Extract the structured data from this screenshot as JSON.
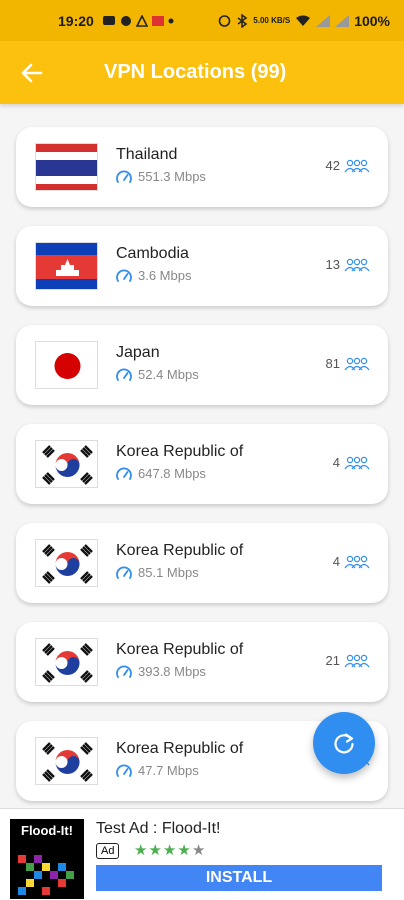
{
  "status_bar": {
    "time": "19:20",
    "battery": "100%",
    "network_speed": "5.00 KB/S"
  },
  "app_bar": {
    "title": "VPN Locations (99)",
    "background": "#fcc10f",
    "back_icon": "arrow-back-icon"
  },
  "locations": [
    {
      "country": "Thailand",
      "speed": "551.3 Mbps",
      "users": "42",
      "flag": "thailand"
    },
    {
      "country": "Cambodia",
      "speed": "3.6 Mbps",
      "users": "13",
      "flag": "cambodia"
    },
    {
      "country": "Japan",
      "speed": "52.4 Mbps",
      "users": "81",
      "flag": "japan"
    },
    {
      "country": "Korea Republic of",
      "speed": "647.8 Mbps",
      "users": "4",
      "flag": "korea"
    },
    {
      "country": "Korea Republic of",
      "speed": "85.1 Mbps",
      "users": "4",
      "flag": "korea"
    },
    {
      "country": "Korea Republic of",
      "speed": "393.8 Mbps",
      "users": "21",
      "flag": "korea"
    },
    {
      "country": "Korea Republic of",
      "speed": "47.7 Mbps",
      "users": "",
      "flag": "korea"
    }
  ],
  "fab": {
    "icon": "refresh-icon",
    "color": "#2f8ef0"
  },
  "ad": {
    "brand": "Flood-It!",
    "title": "Test Ad : Flood-It!",
    "badge": "Ad",
    "rating": 4,
    "install_label": "INSTALL"
  }
}
